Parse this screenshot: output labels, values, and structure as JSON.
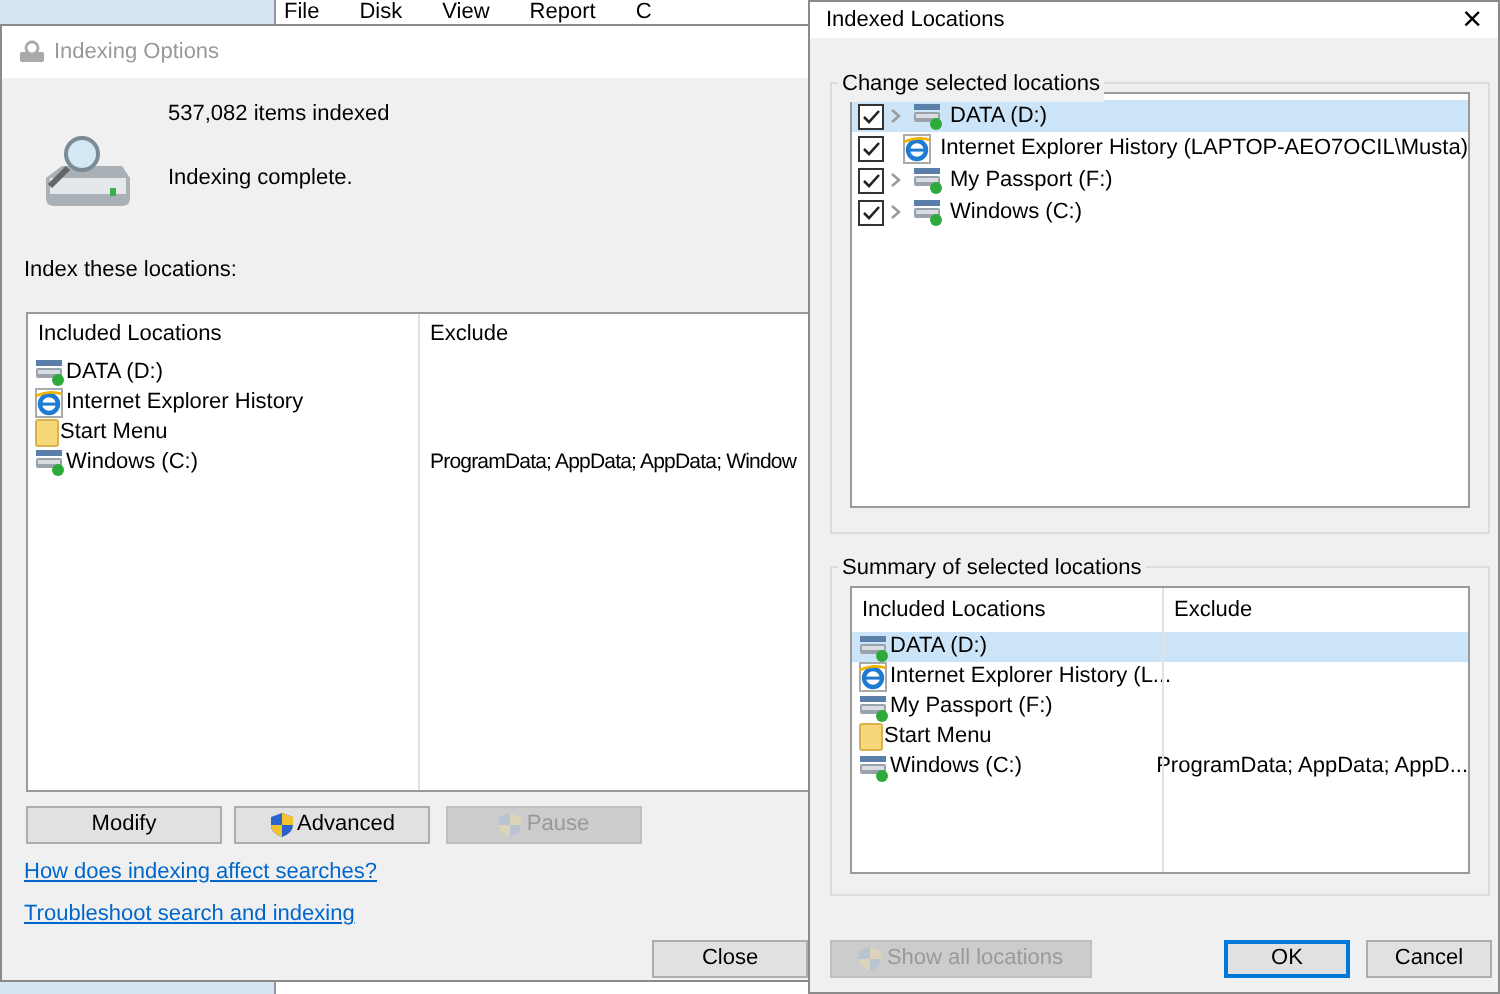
{
  "background_window": {
    "menu": [
      "File",
      "Disk",
      "View",
      "Report",
      "C"
    ]
  },
  "indexing_options": {
    "title": "Indexing Options",
    "active": false,
    "items_indexed": "537,082 items indexed",
    "status": "Indexing complete.",
    "list_label": "Index these locations:",
    "columns": [
      "Included Locations",
      "Exclude"
    ],
    "rows": [
      {
        "kind": "drive",
        "name": "DATA (D:)"
      },
      {
        "kind": "ie",
        "name": "Internet Explorer History"
      },
      {
        "kind": "folder",
        "name": "Start Menu"
      },
      {
        "kind": "drive",
        "name": "Windows (C:)",
        "exclude": "ProgramData; AppData; AppData; Window"
      }
    ],
    "buttons": [
      {
        "label": "Modify",
        "shield": false,
        "disabled": false
      },
      {
        "label": "Advanced",
        "shield": true,
        "disabled": false
      },
      {
        "label": "Pause",
        "shield": true,
        "disabled": true
      }
    ],
    "links": [
      "How does indexing affect searches?",
      "Troubleshoot search and indexing"
    ],
    "close_button": "Close"
  },
  "indexed_locations": {
    "title": "Indexed Locations",
    "close": "×",
    "change_label": "Change selected locations",
    "tree": [
      {
        "kind": "drive",
        "label": "DATA (D:)",
        "checked": true,
        "expandable": true,
        "selected": true
      },
      {
        "kind": "ie",
        "label": "Internet Explorer History (LAPTOP-AEO7OCIL\\Musta)",
        "checked": true,
        "expandable": false,
        "selected": false
      },
      {
        "kind": "drive",
        "label": "My Passport (F:)",
        "checked": true,
        "expandable": true,
        "selected": false
      },
      {
        "kind": "drive",
        "label": "Windows (C:)",
        "checked": true,
        "expandable": true,
        "selected": false
      }
    ],
    "summary_label": "Summary of selected locations",
    "columns": [
      "Included Locations",
      "Exclude"
    ],
    "rows": [
      {
        "kind": "drive",
        "name": "DATA (D:)",
        "selected": true
      },
      {
        "kind": "ie",
        "name": "Internet Explorer History (L...",
        "selected": false
      },
      {
        "kind": "drive",
        "name": "My Passport (F:)",
        "selected": false
      },
      {
        "kind": "folder",
        "name": "Start Menu",
        "selected": false
      },
      {
        "kind": "drive",
        "name": "Windows (C:)",
        "exclude": "ProgramData; AppData; AppD...",
        "selected": false
      }
    ],
    "buttons": [
      {
        "label": "Show all locations",
        "shield": true,
        "disabled": true,
        "default": false
      },
      {
        "label": "OK",
        "shield": false,
        "disabled": false,
        "default": true
      },
      {
        "label": "Cancel",
        "shield": false,
        "disabled": false,
        "default": false
      }
    ]
  }
}
